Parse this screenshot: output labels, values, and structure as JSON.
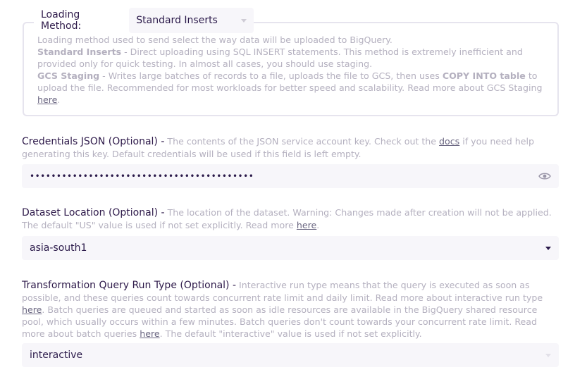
{
  "loading_method": {
    "label": "Loading Method:",
    "selected": "Standard Inserts",
    "desc_intro": "Loading method used to send select the way data will be uploaded to BigQuery.",
    "standard_title": "Standard Inserts",
    "standard_text": " - Direct uploading using SQL INSERT statements. This method is extremely inefficient and provided only for quick testing. In almost all cases, you should use staging.",
    "gcs_title": "GCS Staging",
    "gcs_text_1": " - Writes large batches of records to a file, uploads the file to GCS, then uses ",
    "gcs_bold": "COPY INTO table",
    "gcs_text_2": " to upload the file. Recommended for most workloads for better speed and scalability. Read more about GCS Staging ",
    "gcs_link": "here",
    "gcs_end": "."
  },
  "credentials": {
    "title": "Credentials JSON (Optional) -",
    "desc_1": " The contents of the JSON service account key. Check out the ",
    "docs_link": "docs",
    "desc_2": " if you need help generating this key. Default credentials will be used if this field is left empty.",
    "value": "••••••••••••••••••••••••••••••••••••••••••",
    "icon": "eye-icon"
  },
  "dataset_location": {
    "title": "Dataset Location (Optional) -",
    "desc_1": " The location of the dataset. Warning: Changes made after creation will not be applied. The default \"US\" value is used if not set explicitly. Read more ",
    "link": "here",
    "desc_2": ".",
    "selected": "asia-south1"
  },
  "transformation": {
    "title": "Transformation Query Run Type (Optional) -",
    "desc_1": " Interactive run type means that the query is executed as soon as possible, and these queries count towards concurrent rate limit and daily limit. Read more about interactive run type ",
    "link_1": "here",
    "desc_2": ". Batch queries are queued and started as soon as idle resources are available in the BigQuery shared resource pool, which usually occurs within a few minutes. Batch queries don't count towards your concurrent rate limit. Read more about batch queries ",
    "link_2": "here",
    "desc_3": ". The default \"interactive\" value is used if not set explicitly.",
    "selected": "interactive"
  }
}
